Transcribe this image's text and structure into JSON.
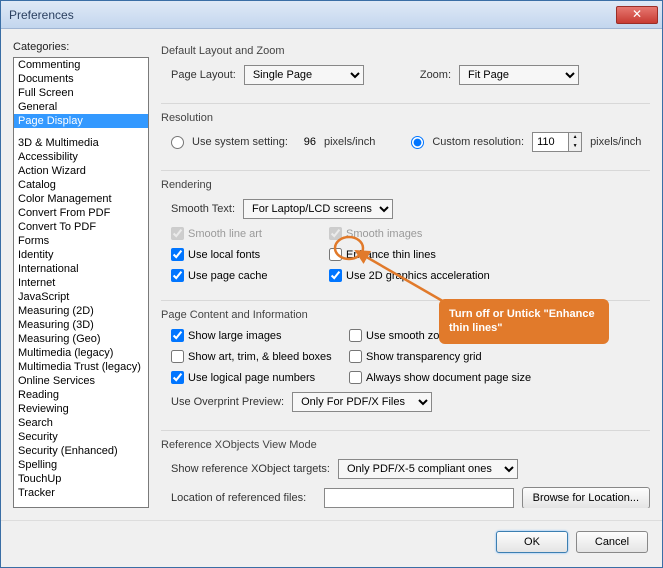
{
  "window": {
    "title": "Preferences"
  },
  "categories_label": "Categories:",
  "categories": [
    "Commenting",
    "Documents",
    "Full Screen",
    "General",
    "Page Display",
    "",
    "3D & Multimedia",
    "Accessibility",
    "Action Wizard",
    "Catalog",
    "Color Management",
    "Convert From PDF",
    "Convert To PDF",
    "Forms",
    "Identity",
    "International",
    "Internet",
    "JavaScript",
    "Measuring (2D)",
    "Measuring (3D)",
    "Measuring (Geo)",
    "Multimedia (legacy)",
    "Multimedia Trust (legacy)",
    "Online Services",
    "Reading",
    "Reviewing",
    "Search",
    "Security",
    "Security (Enhanced)",
    "Spelling",
    "TouchUp",
    "Tracker"
  ],
  "selected_category": "Page Display",
  "sections": {
    "layout": {
      "title": "Default Layout and Zoom",
      "page_layout_label": "Page Layout:",
      "page_layout_value": "Single Page",
      "zoom_label": "Zoom:",
      "zoom_value": "Fit Page"
    },
    "resolution": {
      "title": "Resolution",
      "use_system_label": "Use system setting:",
      "use_system_value": "96",
      "pixels_inch": "pixels/inch",
      "custom_label": "Custom resolution:",
      "custom_value": "110"
    },
    "rendering": {
      "title": "Rendering",
      "smooth_text_label": "Smooth Text:",
      "smooth_text_value": "For Laptop/LCD screens",
      "smooth_line_art": "Smooth line art",
      "smooth_images": "Smooth images",
      "use_local_fonts": "Use local fonts",
      "enhance_thin_lines": "Enhance thin lines",
      "use_page_cache": "Use page cache",
      "use_2d_accel": "Use 2D graphics acceleration"
    },
    "page_content": {
      "title": "Page Content and Information",
      "show_large_images": "Show large images",
      "use_smooth_zooming": "Use smooth zoomin",
      "show_art_trim": "Show art, trim, & bleed boxes",
      "show_transparency_grid": "Show transparency grid",
      "use_logical_page_numbers": "Use logical page numbers",
      "always_show_doc_page_size": "Always show document page size",
      "use_overprint_label": "Use Overprint Preview:",
      "use_overprint_value": "Only For PDF/X Files"
    },
    "xobjects": {
      "title": "Reference XObjects View Mode",
      "show_ref_label": "Show reference XObject targets:",
      "show_ref_value": "Only PDF/X-5 compliant ones",
      "location_label": "Location of referenced files:",
      "location_value": "",
      "browse_label": "Browse for Location..."
    }
  },
  "callout_text": "Turn off or Untick \"Enhance thin lines\"",
  "buttons": {
    "ok": "OK",
    "cancel": "Cancel"
  }
}
